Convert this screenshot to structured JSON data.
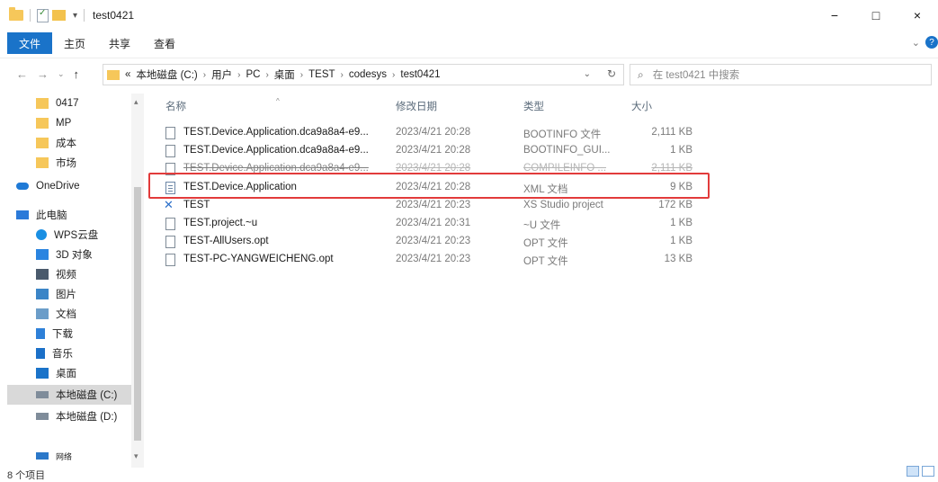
{
  "window": {
    "title": "test0421"
  },
  "window_buttons": {
    "minimize": "−",
    "maximize": "□",
    "close": "×"
  },
  "ribbon": {
    "tabs": [
      "文件",
      "主页",
      "共享",
      "查看"
    ],
    "help": "?"
  },
  "address": {
    "crumbs": [
      "«",
      "本地磁盘 (C:)",
      "用户",
      "PC",
      "桌面",
      "TEST",
      "codesys",
      "test0421"
    ],
    "separator": "›"
  },
  "search": {
    "placeholder": "在 test0421 中搜索"
  },
  "sidebar": {
    "items": [
      {
        "label": "0417",
        "icon": "folder-icon"
      },
      {
        "label": "MP",
        "icon": "folder-icon"
      },
      {
        "label": "成本",
        "icon": "folder-icon"
      },
      {
        "label": "市场",
        "icon": "folder-icon"
      },
      {
        "label": "OneDrive",
        "icon": "cloud-icon"
      },
      {
        "label": "此电脑",
        "icon": "pc-icon"
      },
      {
        "label": "WPS云盘",
        "icon": "wps-icon"
      },
      {
        "label": "3D 对象",
        "icon": "cube-icon"
      },
      {
        "label": "视频",
        "icon": "video-icon"
      },
      {
        "label": "图片",
        "icon": "image-icon"
      },
      {
        "label": "文档",
        "icon": "document-icon"
      },
      {
        "label": "下载",
        "icon": "download-icon"
      },
      {
        "label": "音乐",
        "icon": "music-icon"
      },
      {
        "label": "桌面",
        "icon": "desktop-icon"
      },
      {
        "label": "本地磁盘 (C:)",
        "icon": "drive-icon",
        "selected": true
      },
      {
        "label": "本地磁盘 (D:)",
        "icon": "drive-icon"
      },
      {
        "label": "网络",
        "icon": "network-icon"
      }
    ]
  },
  "columns": {
    "name": "名称",
    "date": "修改日期",
    "type": "类型",
    "size": "大小"
  },
  "files": [
    {
      "name": "TEST.Device.Application.dca9a8a4-e9...",
      "date": "2023/4/21 20:28",
      "type": "BOOTINFO 文件",
      "size": "2,111 KB",
      "icon": "file-icon"
    },
    {
      "name": "TEST.Device.Application.dca9a8a4-e9...",
      "date": "2023/4/21 20:28",
      "type": "BOOTINFO_GUI...",
      "size": "1 KB",
      "icon": "file-icon"
    },
    {
      "name": "TEST.Device.Application.dca9a8a4-e9...",
      "date": "2023/4/21 20:28",
      "type": "COMPILEINFO ...",
      "size": "2,111 KB",
      "icon": "file-icon",
      "struck": true
    },
    {
      "name": "TEST.Device.Application",
      "date": "2023/4/21 20:28",
      "type": "XML 文档",
      "size": "9 KB",
      "icon": "xml-file-icon",
      "highlighted": true
    },
    {
      "name": "TEST",
      "date": "2023/4/21 20:23",
      "type": "XS Studio project",
      "size": "172 KB",
      "icon": "xs-studio-icon"
    },
    {
      "name": "TEST.project.~u",
      "date": "2023/4/21 20:31",
      "type": "~U 文件",
      "size": "1 KB",
      "icon": "file-icon"
    },
    {
      "name": "TEST-AllUsers.opt",
      "date": "2023/4/21 20:23",
      "type": "OPT 文件",
      "size": "1 KB",
      "icon": "file-icon"
    },
    {
      "name": "TEST-PC-YANGWEICHENG.opt",
      "date": "2023/4/21 20:23",
      "type": "OPT 文件",
      "size": "13 KB",
      "icon": "file-icon"
    }
  ],
  "status": {
    "count": "8 个项目"
  },
  "colors": {
    "accent": "#1a73c9",
    "highlight_border": "#e23b3b",
    "folder": "#f6c75a"
  }
}
